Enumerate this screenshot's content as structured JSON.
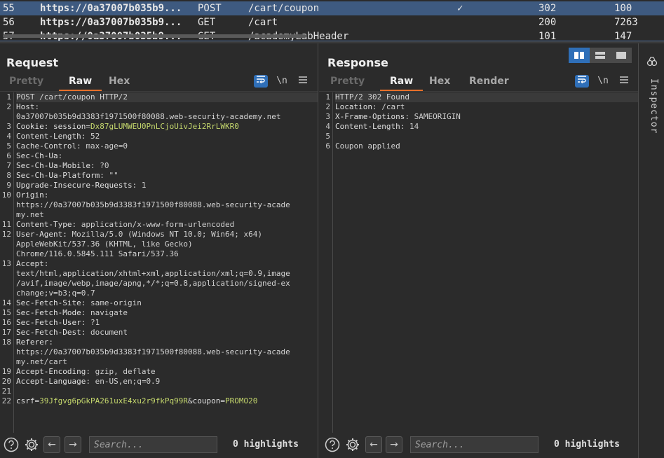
{
  "history": {
    "rows": [
      {
        "num": "55",
        "host": "https://0a37007b035b9...",
        "method": "POST",
        "url": "/cart/coupon",
        "flag": "✓",
        "status": "302",
        "length": "100",
        "selected": true
      },
      {
        "num": "56",
        "host": "https://0a37007b035b9...",
        "method": "GET",
        "url": "/cart",
        "flag": "",
        "status": "200",
        "length": "7263",
        "selected": false
      },
      {
        "num": "57",
        "host": "https://0a37007b035b9...",
        "method": "GET",
        "url": "/academyLabHeader",
        "flag": "",
        "status": "101",
        "length": "147",
        "selected": false
      }
    ]
  },
  "request": {
    "title": "Request",
    "tabs": [
      "Pretty",
      "Raw",
      "Hex"
    ],
    "active_tab": "Raw",
    "newline_toggle": "\\n",
    "lines": [
      {
        "n": "1",
        "text": "POST /cart/coupon HTTP/2"
      },
      {
        "n": "2",
        "key": "Host",
        "value": " "
      },
      {
        "n": "",
        "text": "0a37007b035b9d3383f1971500f80088.web-security-academy.net"
      },
      {
        "n": "3",
        "key": "Cookie",
        "ckey": "session",
        "cval": "Dx87gLUMWEU0PnLCjoUivJei2RrLWKR0"
      },
      {
        "n": "4",
        "key": "Content-Length",
        "value": " 52"
      },
      {
        "n": "5",
        "key": "Cache-Control",
        "value": " max-age=0"
      },
      {
        "n": "6",
        "key": "Sec-Ch-Ua",
        "value": ""
      },
      {
        "n": "7",
        "key": "Sec-Ch-Ua-Mobile",
        "value": " ?0"
      },
      {
        "n": "8",
        "key": "Sec-Ch-Ua-Platform",
        "value": " \"\""
      },
      {
        "n": "9",
        "key": "Upgrade-Insecure-Requests",
        "value": " 1"
      },
      {
        "n": "10",
        "key": "Origin",
        "value": ""
      },
      {
        "n": "",
        "text": "https://0a37007b035b9d3383f1971500f80088.web-security-acade"
      },
      {
        "n": "",
        "text": "my.net"
      },
      {
        "n": "11",
        "key": "Content-Type",
        "value": " application/x-www-form-urlencoded"
      },
      {
        "n": "12",
        "key": "User-Agent",
        "value": " Mozilla/5.0 (Windows NT 10.0; Win64; x64)"
      },
      {
        "n": "",
        "text": "AppleWebKit/537.36 (KHTML, like Gecko)"
      },
      {
        "n": "",
        "text": "Chrome/116.0.5845.111 Safari/537.36"
      },
      {
        "n": "13",
        "key": "Accept",
        "value": ""
      },
      {
        "n": "",
        "text": "text/html,application/xhtml+xml,application/xml;q=0.9,image"
      },
      {
        "n": "",
        "text": "/avif,image/webp,image/apng,*/*;q=0.8,application/signed-ex"
      },
      {
        "n": "",
        "text": "change;v=b3;q=0.7"
      },
      {
        "n": "14",
        "key": "Sec-Fetch-Site",
        "value": " same-origin"
      },
      {
        "n": "15",
        "key": "Sec-Fetch-Mode",
        "value": " navigate"
      },
      {
        "n": "16",
        "key": "Sec-Fetch-User",
        "value": " ?1"
      },
      {
        "n": "17",
        "key": "Sec-Fetch-Dest",
        "value": " document"
      },
      {
        "n": "18",
        "key": "Referer",
        "value": ""
      },
      {
        "n": "",
        "text": "https://0a37007b035b9d3383f1971500f80088.web-security-acade"
      },
      {
        "n": "",
        "text": "my.net/cart"
      },
      {
        "n": "19",
        "key": "Accept-Encoding",
        "value": " gzip, deflate"
      },
      {
        "n": "20",
        "key": "Accept-Language",
        "value": " en-US,en;q=0.9"
      },
      {
        "n": "21",
        "text": ""
      },
      {
        "n": "22",
        "body": [
          {
            "k": "csrf",
            "v": "39Jfgvg6pGkPA261uxE4xu2r9fkPq99R"
          },
          {
            "k": "coupon",
            "v": "PROMO20"
          }
        ]
      }
    ],
    "footer": {
      "search_placeholder": "Search...",
      "highlights": "0 highlights"
    }
  },
  "response": {
    "title": "Response",
    "tabs": [
      "Pretty",
      "Raw",
      "Hex",
      "Render"
    ],
    "active_tab": "Raw",
    "newline_toggle": "\\n",
    "lines": [
      {
        "n": "1",
        "text": "HTTP/2 302 Found"
      },
      {
        "n": "2",
        "key": "Location",
        "value": " /cart"
      },
      {
        "n": "3",
        "key": "X-Frame-Options",
        "value": " SAMEORIGIN"
      },
      {
        "n": "4",
        "key": "Content-Length",
        "value": " 14"
      },
      {
        "n": "5",
        "text": ""
      },
      {
        "n": "6",
        "text": "Coupon applied"
      }
    ],
    "footer": {
      "search_placeholder": "Search...",
      "highlights": "0 highlights"
    }
  },
  "inspector": {
    "label": "Inspector"
  },
  "colors": {
    "accent": "#e8702a",
    "selected_row": "#3e5a80",
    "toggle_active": "#2f6fb8",
    "param_value": "#c5d86d"
  }
}
